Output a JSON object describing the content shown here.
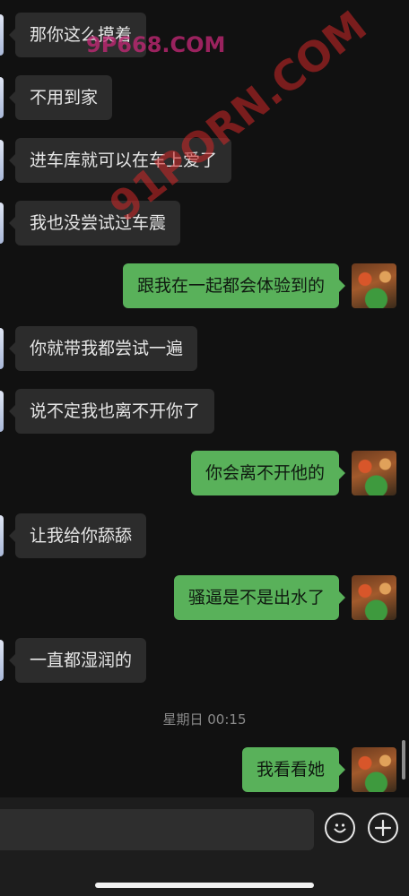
{
  "messages": [
    {
      "side": "in",
      "text": "那你这么摸着"
    },
    {
      "side": "in",
      "text": "不用到家"
    },
    {
      "side": "in",
      "text": "进车库就可以在车上爱了"
    },
    {
      "side": "in",
      "text": "我也没尝试过车震"
    },
    {
      "side": "out",
      "text": "跟我在一起都会体验到的"
    },
    {
      "side": "in",
      "text": "你就带我都尝试一遍"
    },
    {
      "side": "in",
      "text": "说不定我也离不开你了"
    },
    {
      "side": "out",
      "text": "你会离不开他的"
    },
    {
      "side": "in",
      "text": "让我给你舔舔"
    },
    {
      "side": "out",
      "text": "骚逼是不是出水了"
    },
    {
      "side": "in",
      "text": "一直都湿润的"
    },
    {
      "side": "out",
      "text": "我看看她"
    }
  ],
  "timestamp": "星期日 00:15",
  "watermarks": [
    "9P668.COM",
    "91PORN.COM"
  ],
  "colors": {
    "background": "#111111",
    "incoming_bubble": "#2c2c2c",
    "outgoing_bubble": "#59b15a",
    "input_bar": "#1d1d1d"
  },
  "input": {
    "placeholder": ""
  },
  "toolbar": {
    "emoji_icon": "emoji-icon",
    "plus_icon": "plus-icon"
  }
}
